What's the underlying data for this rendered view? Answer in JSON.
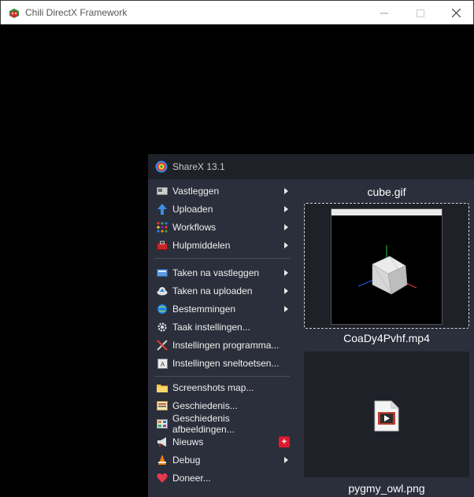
{
  "window": {
    "title": "Chili DirectX Framework",
    "controls": {
      "minimize": "—",
      "maximize": "☐",
      "close": "✕"
    }
  },
  "sharex": {
    "title": "ShareX 13.1",
    "menu": [
      {
        "label": "Vastleggen",
        "icon": "capture-icon",
        "submenu": true
      },
      {
        "label": "Uploaden",
        "icon": "upload-icon",
        "submenu": true
      },
      {
        "label": "Workflows",
        "icon": "workflows-icon",
        "submenu": true
      },
      {
        "label": "Hulpmiddelen",
        "icon": "tools-icon",
        "submenu": true
      },
      {
        "label": "Taken na vastleggen",
        "icon": "after-capture-icon",
        "submenu": true
      },
      {
        "label": "Taken na uploaden",
        "icon": "after-upload-icon",
        "submenu": true
      },
      {
        "label": "Bestemmingen",
        "icon": "destinations-icon",
        "submenu": true
      },
      {
        "label": "Taak instellingen...",
        "icon": "gear-icon",
        "submenu": false
      },
      {
        "label": "Instellingen programma...",
        "icon": "wrench-icon",
        "submenu": false
      },
      {
        "label": "Instellingen sneltoetsen...",
        "icon": "hotkeys-icon",
        "submenu": false
      },
      {
        "label": "Screenshots map...",
        "icon": "folder-icon",
        "submenu": false
      },
      {
        "label": "Geschiedenis...",
        "icon": "history-icon",
        "submenu": false
      },
      {
        "label": "Geschiedenis afbeeldingen...",
        "icon": "image-history-icon",
        "submenu": false
      },
      {
        "label": "Nieuws",
        "icon": "megaphone-icon",
        "submenu": false,
        "badge": "+"
      },
      {
        "label": "Debug",
        "icon": "debug-icon",
        "submenu": true
      },
      {
        "label": "Doneer...",
        "icon": "heart-icon",
        "submenu": false
      }
    ],
    "thumbnails": [
      {
        "filename": "cube.gif",
        "selected": true
      },
      {
        "filename": "CoaDy4Pvhf.mp4",
        "selected": false
      },
      {
        "filename": "pygmy_owl.png",
        "selected": false
      }
    ]
  },
  "colors": {
    "panel_bg": "#2b2e3b",
    "title_bg": "#1f2129",
    "text": "#f0f0f0",
    "badge": "#e0182d"
  }
}
